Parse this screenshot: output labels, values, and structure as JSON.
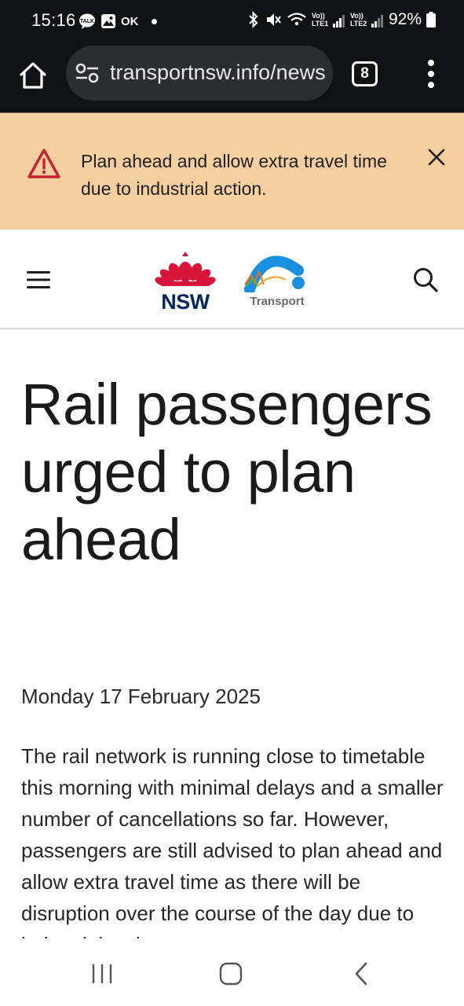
{
  "status_bar": {
    "time": "15:16",
    "left_icons": [
      "talk-icon",
      "gallery-icon",
      "ok-icon",
      "dot-icon"
    ],
    "right_icons": [
      "bluetooth-icon",
      "mute-icon",
      "wifi-icon",
      "signal-lte1-icon",
      "signal-lte2-icon",
      "battery-icon"
    ],
    "ok_label": "OK",
    "lte1_label": "Vo)) LTE1",
    "lte2_label": "Vo)) LTE2",
    "battery_percent": "92%",
    "battery_level": 0.92
  },
  "browser": {
    "url": "transportnsw.info/news",
    "tab_count": "8",
    "icons": [
      "home-icon",
      "site-settings-icon",
      "tabs-icon",
      "more-menu-icon"
    ]
  },
  "alert": {
    "message": "Plan ahead and allow extra travel time due to industrial action.",
    "icon": "warning-triangle-icon",
    "close_icon": "close-icon",
    "background": "#f6cfa0",
    "icon_color": "#c8202f"
  },
  "header": {
    "nsw_logo_text": "NSW",
    "transport_logo_text": "Transport",
    "menu_icon": "hamburger-menu-icon",
    "search_icon": "search-icon",
    "brand_red": "#d7153a",
    "brand_navy": "#002664",
    "brand_blue": "#1a8fe0"
  },
  "article": {
    "headline": "Rail passengers urged to plan ahead",
    "date": "Monday 17 February 2025",
    "body": "The rail network is running close to timetable this morning with minimal delays and a smaller number of cancellations so far. However, passengers are still advised to plan ahead and allow extra travel time as there will be disruption over the course of the day due to industrial action."
  },
  "nav_bar": {
    "icons": [
      "recent-apps-icon",
      "home-button-icon",
      "back-icon"
    ]
  }
}
